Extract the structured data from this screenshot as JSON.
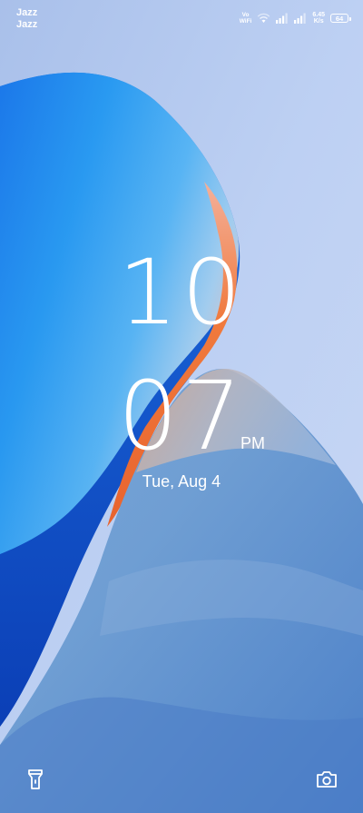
{
  "status_bar": {
    "carrier_1": "Jazz",
    "carrier_2": "Jazz",
    "vowifi_top": "Vo",
    "vowifi_bottom": "WiFi",
    "speed_value": "6.45",
    "speed_unit": "K/s",
    "battery_level": "64",
    "icons": [
      "vowifi-icon",
      "wifi-icon",
      "signal-sim1-icon",
      "signal-sim2-icon",
      "battery-icon"
    ]
  },
  "lock_screen": {
    "hour": "10",
    "minute": "07",
    "ampm": "PM",
    "date": "Tue, Aug 4"
  },
  "shortcuts": {
    "left_icon": "flashlight-icon",
    "right_icon": "camera-icon"
  },
  "colors": {
    "sky": "#b9cbee",
    "ribbon_blue": "#1f7be6",
    "ribbon_orange": "#f0703a",
    "text": "#ffffff"
  }
}
